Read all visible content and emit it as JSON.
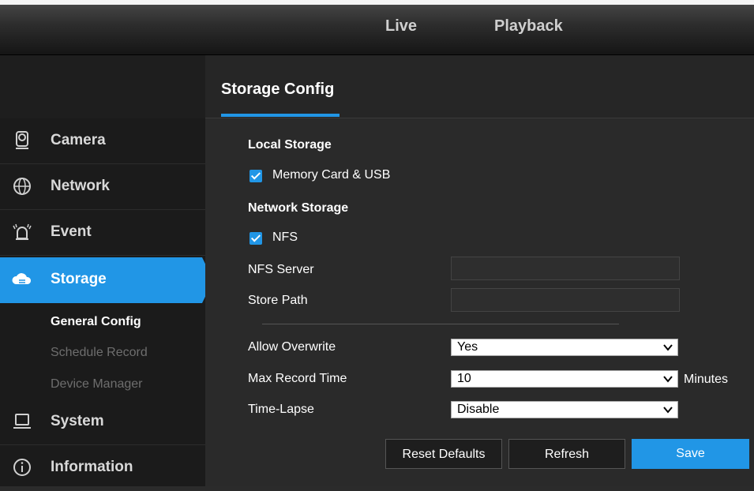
{
  "top_nav": {
    "tabs": [
      {
        "label": "Live"
      },
      {
        "label": "Playback"
      }
    ]
  },
  "sidebar": {
    "items": [
      {
        "label": "Camera",
        "icon": "camera-icon"
      },
      {
        "label": "Network",
        "icon": "globe-icon"
      },
      {
        "label": "Event",
        "icon": "alarm-icon"
      },
      {
        "label": "Storage",
        "icon": "cloud-storage-icon",
        "active": true
      },
      {
        "label": "System",
        "icon": "laptop-icon"
      },
      {
        "label": "Information",
        "icon": "info-icon"
      }
    ],
    "storage_sub": [
      {
        "label": "General Config",
        "active": true
      },
      {
        "label": "Schedule Record"
      },
      {
        "label": "Device Manager"
      }
    ]
  },
  "page": {
    "title": "Storage Config"
  },
  "local_storage": {
    "heading": "Local Storage",
    "memory_card_label": "Memory Card & USB",
    "memory_card_checked": true
  },
  "network_storage": {
    "heading": "Network Storage",
    "nfs_label": "NFS",
    "nfs_checked": true,
    "nfs_server_label": "NFS Server",
    "nfs_server_value": "",
    "store_path_label": "Store Path",
    "store_path_value": ""
  },
  "settings": {
    "allow_overwrite_label": "Allow Overwrite",
    "allow_overwrite_value": "Yes",
    "max_record_time_label": "Max Record Time",
    "max_record_time_value": "10",
    "max_record_time_unit": "Minutes",
    "time_lapse_label": "Time-Lapse",
    "time_lapse_value": "Disable"
  },
  "buttons": {
    "reset_label": "Reset Defaults",
    "refresh_label": "Refresh",
    "save_label": "Save"
  },
  "colors": {
    "accent": "#2196e6",
    "sidebar_bg": "#1b1b1b",
    "content_bg": "#2a2a2a"
  }
}
